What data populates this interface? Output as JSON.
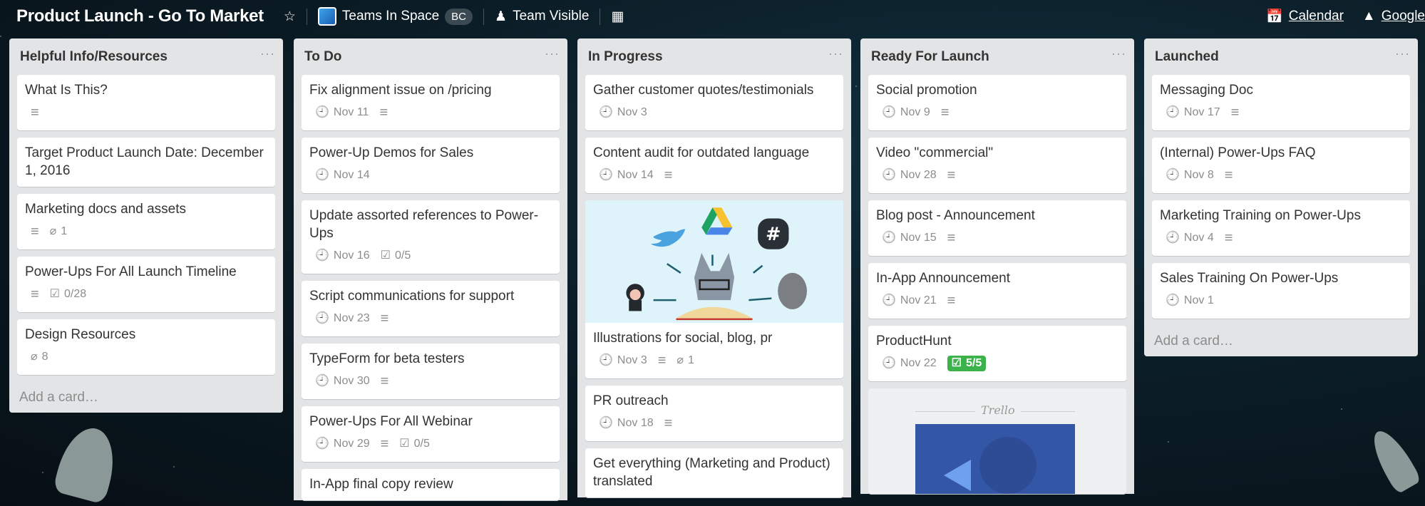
{
  "header": {
    "title": "Product Launch - Go To Market",
    "team": "Teams In Space",
    "team_badge": "BC",
    "visibility": "Team Visible",
    "calendar": "Calendar",
    "google": "Google"
  },
  "colors": {
    "list_bg": "#e2e4e6",
    "complete_green": "#3cb34a",
    "background": "#0b1d27"
  },
  "add_card_label": "Add a card…",
  "cover_logo": "Trello",
  "lists": [
    {
      "title": "Helpful Info/Resources",
      "show_add": true,
      "cards": [
        {
          "title": "What Is This?",
          "desc": true
        },
        {
          "title": "Target Product Launch Date: December 1, 2016"
        },
        {
          "title": "Marketing docs and assets",
          "desc": true,
          "attachments": "1"
        },
        {
          "title": "Power-Ups For All Launch Timeline",
          "desc": true,
          "checklist": "0/28"
        },
        {
          "title": "Design Resources",
          "attachments": "8"
        }
      ]
    },
    {
      "title": "To Do",
      "cards": [
        {
          "title": "Fix alignment issue on /pricing",
          "due": "Nov 11",
          "desc": true
        },
        {
          "title": "Power-Up Demos for Sales",
          "due": "Nov 14"
        },
        {
          "title": "Update assorted references to Power-Ups",
          "due": "Nov 16",
          "checklist": "0/5"
        },
        {
          "title": "Script communications for support",
          "due": "Nov 23",
          "desc": true
        },
        {
          "title": "TypeForm for beta testers",
          "due": "Nov 30",
          "desc": true
        },
        {
          "title": "Power-Ups For All Webinar",
          "due": "Nov 29",
          "desc": true,
          "checklist": "0/5"
        },
        {
          "title": "In-App final copy review"
        }
      ]
    },
    {
      "title": "In Progress",
      "cards": [
        {
          "title": "Gather customer quotes/testimonials",
          "due": "Nov 3"
        },
        {
          "title": "Content audit for outdated language",
          "due": "Nov 14",
          "desc": true
        },
        {
          "title": "Illustrations for social, blog, pr",
          "due": "Nov 3",
          "desc": true,
          "attachments": "1",
          "cover": "illustration"
        },
        {
          "title": "PR outreach",
          "due": "Nov 18",
          "desc": true
        },
        {
          "title": "Get everything (Marketing and Product) translated"
        }
      ]
    },
    {
      "title": "Ready For Launch",
      "cards": [
        {
          "title": "Social promotion",
          "due": "Nov 9",
          "desc": true
        },
        {
          "title": "Video \"commercial\"",
          "due": "Nov 28",
          "desc": true
        },
        {
          "title": "Blog post - Announcement",
          "due": "Nov 15",
          "desc": true
        },
        {
          "title": "In-App Announcement",
          "due": "Nov 21",
          "desc": true
        },
        {
          "title": "ProductHunt",
          "due": "Nov 22",
          "checklist": "5/5",
          "checklist_complete": true
        },
        {
          "cover": "email"
        }
      ]
    },
    {
      "title": "Launched",
      "show_add": true,
      "cards": [
        {
          "title": "Messaging Doc",
          "due": "Nov 17",
          "desc": true
        },
        {
          "title": "(Internal) Power-Ups FAQ",
          "due": "Nov 8",
          "desc": true
        },
        {
          "title": "Marketing Training on Power-Ups",
          "due": "Nov 4",
          "desc": true
        },
        {
          "title": "Sales Training On Power-Ups",
          "due": "Nov 1"
        }
      ]
    }
  ]
}
